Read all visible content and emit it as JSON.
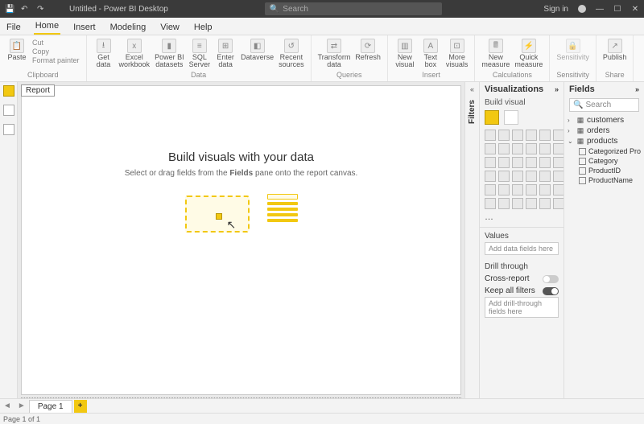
{
  "titlebar": {
    "title": "Untitled - Power BI Desktop",
    "search_placeholder": "Search",
    "signin": "Sign in",
    "min": "—",
    "max": "☐",
    "close": "✕"
  },
  "tabs": [
    "File",
    "Home",
    "Insert",
    "Modeling",
    "View",
    "Help"
  ],
  "active_tab": 1,
  "ribbon": {
    "clipboard": {
      "paste": "Paste",
      "cut": "Cut",
      "copy": "Copy",
      "fp": "Format painter",
      "label": "Clipboard"
    },
    "data": {
      "get": "Get\ndata",
      "excel": "Excel\nworkbook",
      "pbi": "Power BI\ndatasets",
      "sql": "SQL\nServer",
      "enter": "Enter\ndata",
      "dv": "Dataverse",
      "recent": "Recent\nsources",
      "label": "Data"
    },
    "queries": {
      "transform": "Transform\ndata",
      "refresh": "Refresh",
      "label": "Queries"
    },
    "insert": {
      "nv": "New\nvisual",
      "tb": "Text\nbox",
      "mv": "More\nvisuals",
      "label": "Insert"
    },
    "calc": {
      "nm": "New\nmeasure",
      "qm": "Quick\nmeasure",
      "label": "Calculations"
    },
    "sens": {
      "s": "Sensitivity",
      "label": "Sensitivity"
    },
    "share": {
      "p": "Publish",
      "label": "Share"
    }
  },
  "canvas": {
    "report_tag": "Report",
    "headline": "Build visuals with your data",
    "sub_a": "Select or drag fields from the ",
    "sub_b": "Fields",
    "sub_c": " pane onto the report canvas."
  },
  "filters_label": "Filters",
  "vis": {
    "title": "Visualizations",
    "sub": "Build visual",
    "values": "Values",
    "values_ph": "Add data fields here",
    "drill": "Drill through",
    "cross": "Cross-report",
    "keep": "Keep all filters",
    "drill_ph": "Add drill-through fields here"
  },
  "fields": {
    "title": "Fields",
    "search": "Search",
    "tables": [
      {
        "name": "customers",
        "expanded": false
      },
      {
        "name": "orders",
        "expanded": false
      },
      {
        "name": "products",
        "expanded": true,
        "cols": [
          "Categorized Pro…",
          "Category",
          "ProductID",
          "ProductName"
        ]
      }
    ]
  },
  "pagebar": {
    "page": "Page 1",
    "add": "+"
  },
  "status": "Page 1 of 1"
}
